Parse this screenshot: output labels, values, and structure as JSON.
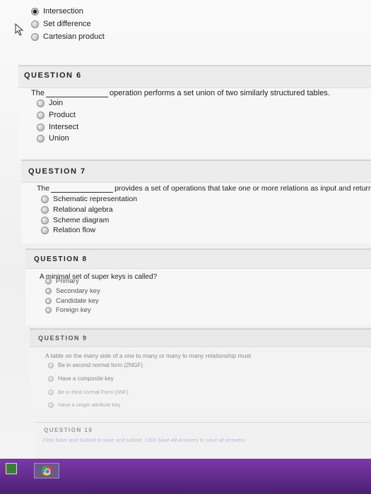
{
  "q5": {
    "options": [
      {
        "label": "Intersection",
        "selected": true
      },
      {
        "label": "Set difference",
        "selected": false
      },
      {
        "label": "Cartesian product",
        "selected": false
      }
    ]
  },
  "q6": {
    "title": "QUESTION 6",
    "stem_prefix": "The",
    "stem_suffix": "operation performs a set union of two similarly structured tables.",
    "options": [
      "Join",
      "Product",
      "Intersect",
      "Union"
    ]
  },
  "q7": {
    "title": "QUESTION 7",
    "stem_prefix": "The",
    "stem_suffix": "provides a set of operations that take one or more relations as input and returns a r",
    "options": [
      "Schematic representation",
      "Relational algebra",
      "Scheme diagram",
      "Relation flow"
    ]
  },
  "q8": {
    "title": "QUESTION 8",
    "stem": "A minimal set of super keys is called?",
    "options": [
      "Primary",
      "Secondary key",
      "Candidate key",
      "Foreign key"
    ]
  },
  "q9": {
    "title": "QUESTION 9",
    "stem": "A table on the many side of a one to many or many to many relationship must",
    "options": [
      "Be in second normal form (2NGF)",
      "Have a composite key",
      "Be in third normal Form (3NF)",
      "Have a single attribute key"
    ]
  },
  "q10": {
    "title": "QUESTION 10",
    "footer": "Click Save and Submit to save and submit. Click Save All Answers to save all answers."
  }
}
